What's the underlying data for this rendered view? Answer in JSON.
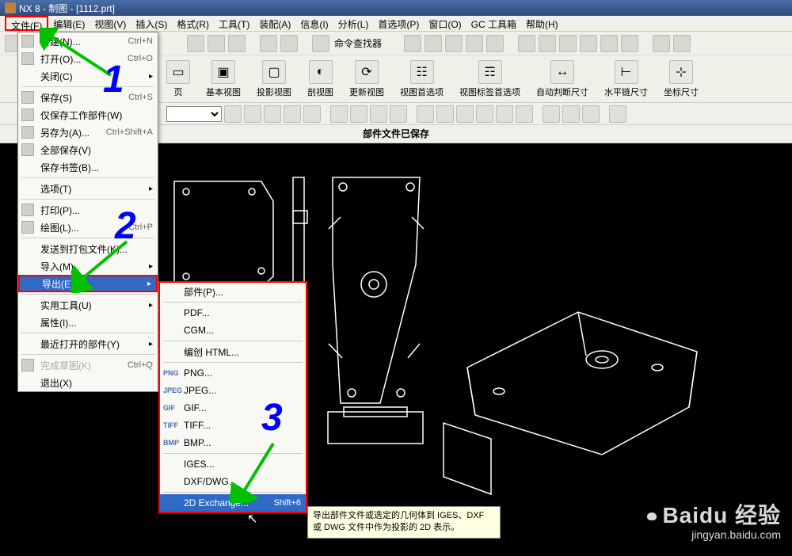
{
  "title": "NX 8 - 制图 - [1112.prt]",
  "menubar": [
    "文件(F)",
    "编辑(E)",
    "视图(V)",
    "插入(S)",
    "格式(R)",
    "工具(T)",
    "装配(A)",
    "信息(I)",
    "分析(L)",
    "首选项(P)",
    "窗口(O)",
    "GC 工具箱",
    "帮助(H)"
  ],
  "finder_label": "命令查找器",
  "ribbon": [
    {
      "label": "页",
      "icon": "▭"
    },
    {
      "label": "基本视图",
      "icon": "▣"
    },
    {
      "label": "投影视图",
      "icon": "▢"
    },
    {
      "label": "剖视图",
      "icon": "◐"
    },
    {
      "label": "更新视图",
      "icon": "⟳"
    },
    {
      "label": "视图首选项",
      "icon": "☷"
    },
    {
      "label": "视图标签首选项",
      "icon": "☶"
    },
    {
      "label": "自动判断尺寸",
      "icon": "↔"
    },
    {
      "label": "水平链尺寸",
      "icon": "⊢"
    },
    {
      "label": "坐标尺寸",
      "icon": "⊹"
    }
  ],
  "status_message": "部件文件已保存",
  "file_menu": [
    {
      "label": "新建(N)...",
      "short": "Ctrl+N",
      "icon": true
    },
    {
      "label": "打开(O)...",
      "short": "Ctrl+O",
      "icon": true
    },
    {
      "label": "关闭(C)",
      "arrow": true
    },
    {
      "sep": true
    },
    {
      "label": "保存(S)",
      "short": "Ctrl+S",
      "icon": true
    },
    {
      "label": "仅保存工作部件(W)",
      "icon": true
    },
    {
      "label": "另存为(A)...",
      "short": "Ctrl+Shift+A",
      "icon": true
    },
    {
      "label": "全部保存(V)",
      "icon": true
    },
    {
      "label": "保存书签(B)..."
    },
    {
      "sep": true
    },
    {
      "label": "选项(T)",
      "arrow": true
    },
    {
      "sep": true
    },
    {
      "label": "打印(P)...",
      "icon": true
    },
    {
      "label": "绘图(L)...",
      "short": "Ctrl+P",
      "icon": true
    },
    {
      "sep": true
    },
    {
      "label": "发送到打包文件(K)..."
    },
    {
      "label": "导入(M)",
      "arrow": true
    },
    {
      "label": "导出(E)",
      "arrow": true,
      "hl": true
    },
    {
      "sep": true
    },
    {
      "label": "实用工具(U)",
      "arrow": true
    },
    {
      "label": "属性(I)..."
    },
    {
      "sep": true
    },
    {
      "label": "最近打开的部件(Y)",
      "arrow": true
    },
    {
      "sep": true
    },
    {
      "label": "完成草图(K)",
      "short": "Ctrl+Q",
      "icon": true,
      "disabled": true
    },
    {
      "label": "退出(X)"
    }
  ],
  "export_submenu": [
    {
      "label": "部件(P)..."
    },
    {
      "sep": true
    },
    {
      "label": "PDF..."
    },
    {
      "label": "CGM..."
    },
    {
      "sep": true
    },
    {
      "label": "编创 HTML..."
    },
    {
      "sep": true
    },
    {
      "label": "PNG...",
      "icon": "PNG"
    },
    {
      "label": "JPEG...",
      "icon": "JPEG"
    },
    {
      "label": "GIF...",
      "icon": "GIF"
    },
    {
      "label": "TIFF...",
      "icon": "TIFF"
    },
    {
      "label": "BMP...",
      "icon": "BMP"
    },
    {
      "sep": true
    },
    {
      "label": "IGES..."
    },
    {
      "label": "DXF/DWG..."
    },
    {
      "sep": true
    },
    {
      "label": "2D Exchange...",
      "short": "Shift+6",
      "hl": true
    }
  ],
  "tooltip_text": "导出部件文件或选定的几何体到 IGES、DXF 或 DWG 文件中作为投影的 2D 表示。",
  "numbers": {
    "one": "1",
    "two": "2",
    "three": "3"
  },
  "watermark": {
    "main": "Baidu 经验",
    "sub": "jingyan.baidu.com"
  }
}
